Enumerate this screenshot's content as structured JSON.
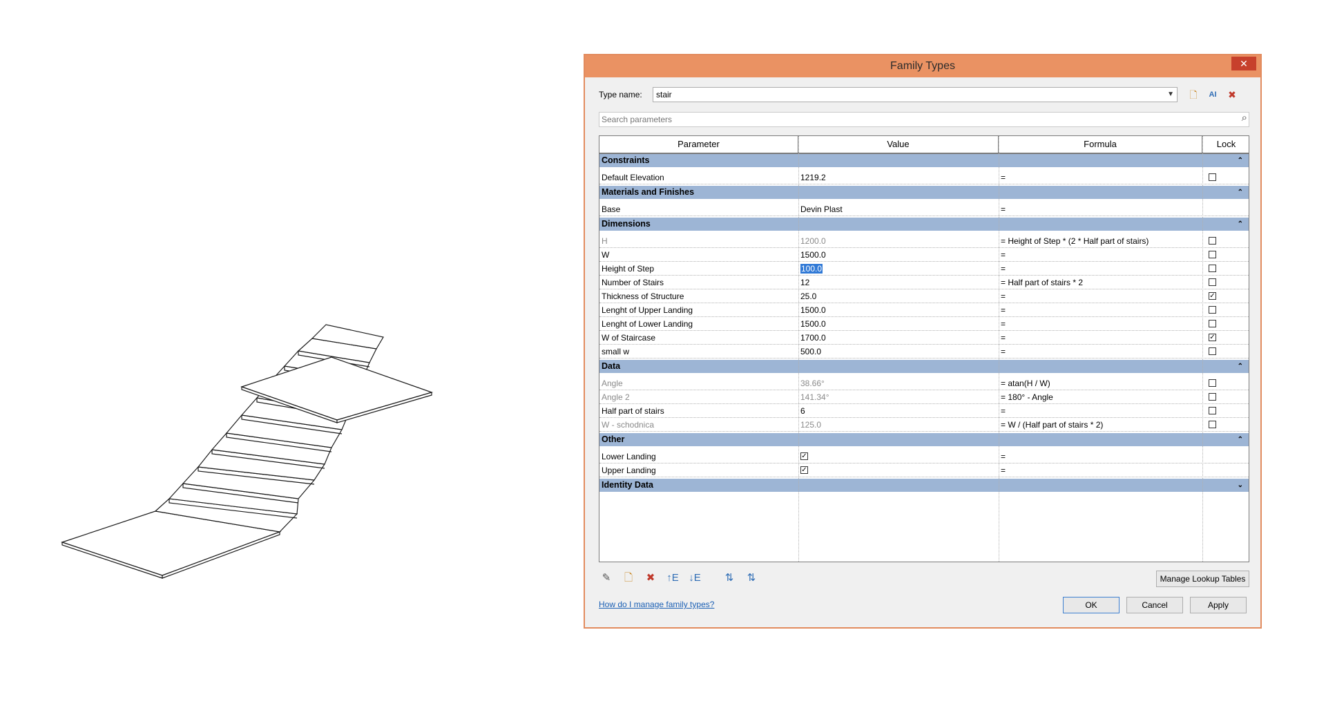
{
  "dialog": {
    "title": "Family Types",
    "close_glyph": "✕",
    "type_name_label": "Type name:",
    "type_name_value": "stair",
    "search_placeholder": "Search parameters",
    "columns": [
      "Parameter",
      "Value",
      "Formula",
      "Lock"
    ],
    "groups": [
      {
        "name": "Constraints",
        "expanded": true,
        "rows": [
          {
            "param": "Default Elevation",
            "value": "1219.2",
            "formula": "=",
            "lock": false,
            "has_lock": true,
            "gray": false
          }
        ]
      },
      {
        "name": "Materials and Finishes",
        "expanded": true,
        "rows": [
          {
            "param": "Base",
            "value": "Devin Plast",
            "formula": "=",
            "has_lock": false,
            "gray": false
          }
        ]
      },
      {
        "name": "Dimensions",
        "expanded": true,
        "rows": [
          {
            "param": "H",
            "value": "1200.0",
            "formula": "= Height of Step * (2 * Half part of stairs)",
            "lock": false,
            "has_lock": true,
            "gray": true
          },
          {
            "param": "W",
            "value": "1500.0",
            "formula": "=",
            "lock": false,
            "has_lock": true,
            "gray": false
          },
          {
            "param": "Height of Step",
            "value": "100.0",
            "formula": "=",
            "lock": false,
            "has_lock": true,
            "gray": false,
            "selected": true
          },
          {
            "param": "Number of Stairs",
            "value": "12",
            "formula": "= Half part of stairs * 2",
            "lock": false,
            "has_lock": true,
            "gray": false
          },
          {
            "param": "Thickness of Structure",
            "value": "25.0",
            "formula": "=",
            "lock": true,
            "has_lock": true,
            "gray": false
          },
          {
            "param": "Lenght of Upper Landing",
            "value": "1500.0",
            "formula": "=",
            "lock": false,
            "has_lock": true,
            "gray": false
          },
          {
            "param": "Lenght of Lower Landing",
            "value": "1500.0",
            "formula": "=",
            "lock": false,
            "has_lock": true,
            "gray": false
          },
          {
            "param": "W of Staircase",
            "value": "1700.0",
            "formula": "=",
            "lock": true,
            "has_lock": true,
            "gray": false
          },
          {
            "param": "small w",
            "value": "500.0",
            "formula": "=",
            "lock": false,
            "has_lock": true,
            "gray": false
          }
        ]
      },
      {
        "name": "Data",
        "expanded": true,
        "rows": [
          {
            "param": "Angle",
            "value": "38.66°",
            "formula": "= atan(H / W)",
            "lock": false,
            "has_lock": true,
            "gray": true
          },
          {
            "param": "Angle 2",
            "value": "141.34°",
            "formula": "= 180° - Angle",
            "lock": false,
            "has_lock": true,
            "gray": true
          },
          {
            "param": "Half part of stairs",
            "value": "6",
            "formula": "=",
            "lock": false,
            "has_lock": true,
            "gray": false
          },
          {
            "param": "W - schodnica",
            "value": "125.0",
            "formula": "= W / (Half part of stairs * 2)",
            "lock": false,
            "has_lock": true,
            "gray": true
          }
        ]
      },
      {
        "name": "Other",
        "expanded": true,
        "rows": [
          {
            "param": "Lower Landing",
            "value_check": true,
            "formula": "=",
            "has_lock": false,
            "gray": false
          },
          {
            "param": "Upper Landing",
            "value_check": true,
            "formula": "=",
            "has_lock": false,
            "gray": false
          }
        ]
      },
      {
        "name": "Identity Data",
        "expanded": false,
        "rows": []
      }
    ],
    "manage_lookup_label": "Manage Lookup Tables",
    "help_link": "How do I manage family types?",
    "ok_label": "OK",
    "cancel_label": "Cancel",
    "apply_label": "Apply"
  }
}
